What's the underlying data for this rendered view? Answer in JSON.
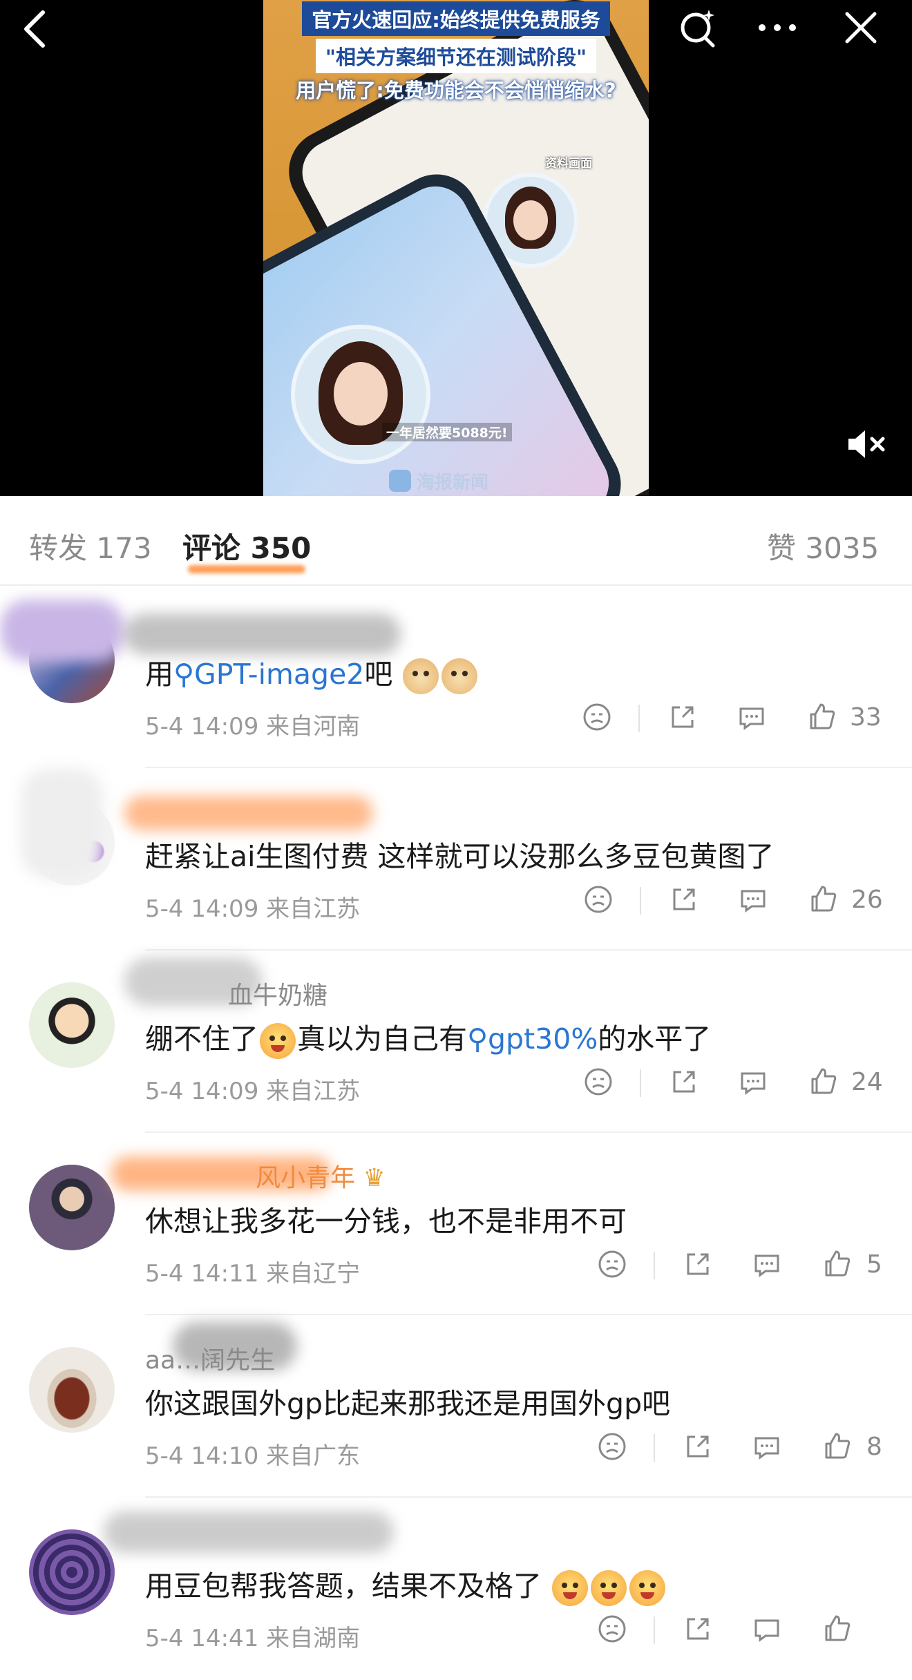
{
  "video": {
    "caption_line1": "官方火速回应:始终提供免费服务",
    "caption_line2": "\"相关方案细节还在测试阶段\"",
    "caption_line3": "用户慌了:免费功能会不会悄悄缩水?",
    "tag_picture": "资料画面",
    "tag_price": "一年居然要5088元!",
    "watermark": "海报新闻",
    "colors": {
      "caption_blue": "#1d4b9a",
      "background": "#000000"
    }
  },
  "stats": {
    "repost_label": "转发",
    "repost_count": "173",
    "comment_label": "评论",
    "comment_count": "350",
    "like_label": "赞",
    "like_count": "3035",
    "accent": "#ff8c3a"
  },
  "comments": [
    {
      "name": "",
      "pre": "用",
      "link": "GPT-image2",
      "post": "吧",
      "emoji": "doge-doge",
      "time": "5-4 14:09",
      "location": "来自河南",
      "likes": "33"
    },
    {
      "name": "",
      "text": "赶紧让ai生图付费 这样就可以没那么多豆包黄图了",
      "time": "5-4 14:09",
      "location": "来自江苏",
      "likes": "26"
    },
    {
      "name": "血牛奶糖",
      "pre": "绷不住了",
      "mid": "真以为自己有",
      "link": "gpt30%",
      "post": "的水平了",
      "emoji": "laugh-cry",
      "time": "5-4 14:09",
      "location": "来自江苏",
      "likes": "24"
    },
    {
      "name": "风小青年",
      "text": "休想让我多花一分钱，也不是非用不可",
      "time": "5-4 14:11",
      "location": "来自辽宁",
      "likes": "5",
      "badge": "crown-icon"
    },
    {
      "name": "aa…阔先生",
      "text": "你这跟国外gp比起来那我还是用国外gp吧",
      "time": "5-4 14:10",
      "location": "来自广东",
      "likes": "8"
    },
    {
      "name": "",
      "text": "用豆包帮我答题，结果不及格了",
      "emoji": "cry-cry-cry",
      "time": "5-4 14:41",
      "location": "来自湖南",
      "likes": ""
    }
  ]
}
